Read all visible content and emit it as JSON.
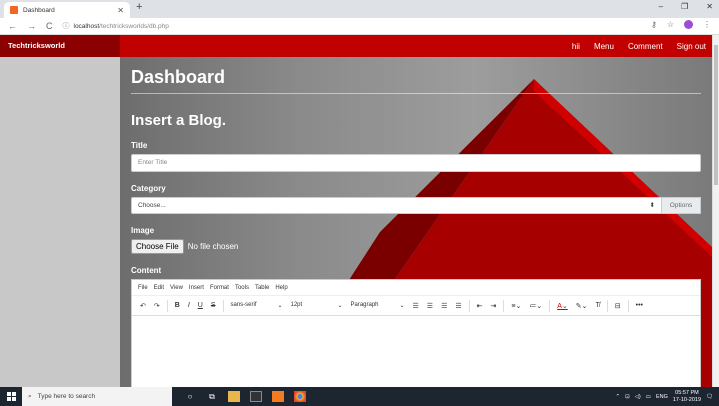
{
  "browser": {
    "tab_title": "Dashboard",
    "url_host": "localhost",
    "url_path": "/techtricksworlds/db.php",
    "new_tab": "+",
    "window_controls": [
      "–",
      "❐",
      "✕"
    ]
  },
  "app": {
    "brand": "Techtricksworld",
    "nav": [
      "hii",
      "Menu",
      "Comment",
      "Sign out"
    ],
    "page_title": "Dashboard",
    "section_title": "Insert a Blog."
  },
  "form": {
    "title_label": "Title",
    "title_placeholder": "Enter Title",
    "category_label": "Category",
    "category_value": "Choose...",
    "options_label": "Options",
    "image_label": "Image",
    "file_button": "Choose File",
    "file_status": "No file chosen",
    "content_label": "Content"
  },
  "editor": {
    "menu": [
      "File",
      "Edit",
      "View",
      "Insert",
      "Format",
      "Tools",
      "Table",
      "Help"
    ],
    "font_family": "sans-serif",
    "font_size": "12pt",
    "block_format": "Paragraph",
    "more": "•••"
  },
  "taskbar": {
    "search_placeholder": "Type here to search",
    "language": "ENG",
    "time": "05:57 PM",
    "date": "17-10-2019"
  },
  "colors": {
    "nav_red": "#c10000",
    "brand_red": "#8b0000",
    "taskbar": "#1c2530"
  }
}
